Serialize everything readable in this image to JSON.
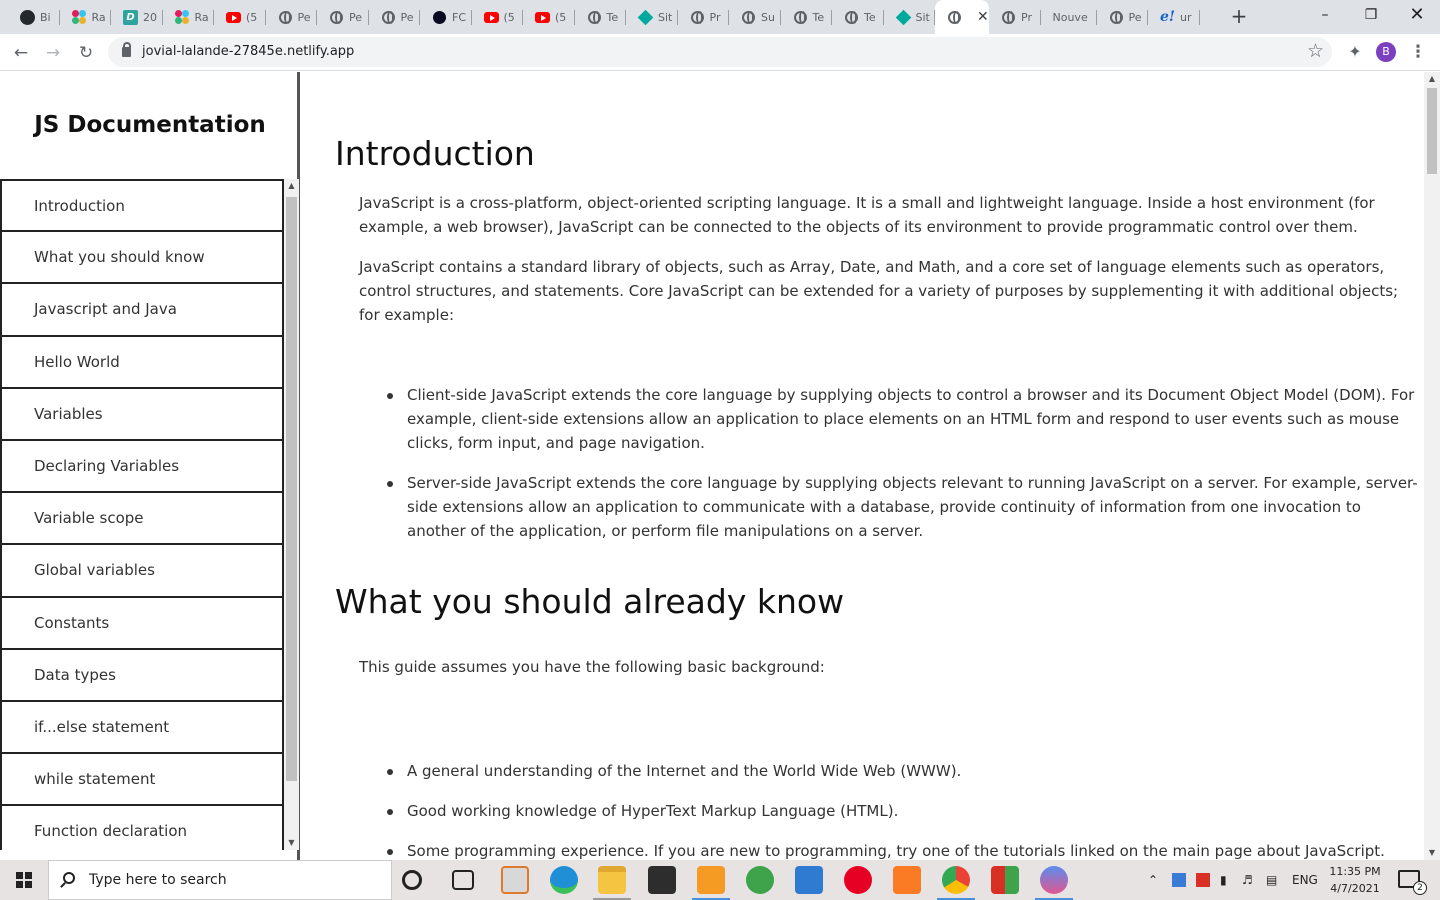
{
  "browser": {
    "tabs": [
      {
        "label": "Bi",
        "favicon": "github-icon"
      },
      {
        "label": "Ra",
        "favicon": "slack-icon"
      },
      {
        "label": "20",
        "favicon": "d-icon"
      },
      {
        "label": "Ra",
        "favicon": "slack-icon"
      },
      {
        "label": "(5",
        "favicon": "youtube-icon"
      },
      {
        "label": "Pe",
        "favicon": "globe-icon"
      },
      {
        "label": "Pe",
        "favicon": "globe-icon"
      },
      {
        "label": "Pe",
        "favicon": "globe-icon"
      },
      {
        "label": "FC",
        "favicon": "freecodecamp-icon"
      },
      {
        "label": "(5",
        "favicon": "youtube-icon"
      },
      {
        "label": "(5",
        "favicon": "youtube-icon"
      },
      {
        "label": "Te",
        "favicon": "globe-icon"
      },
      {
        "label": "Sit",
        "favicon": "diamond-icon"
      },
      {
        "label": "Pr",
        "favicon": "globe-icon"
      },
      {
        "label": "Su",
        "favicon": "globe-icon"
      },
      {
        "label": "Te",
        "favicon": "globe-icon"
      },
      {
        "label": "Te",
        "favicon": "globe-icon"
      },
      {
        "label": "Sit",
        "favicon": "diamond-icon"
      },
      {
        "label": "",
        "favicon": "globe-icon",
        "active": true
      },
      {
        "label": "Pr",
        "favicon": "globe-icon"
      },
      {
        "label": "Nouve",
        "favicon": ""
      },
      {
        "label": "Pe",
        "favicon": "globe-icon"
      },
      {
        "label": "ur",
        "favicon": "e-icon"
      }
    ],
    "url": "jovial-lalande-27845e.netlify.app",
    "profile_initial": "B"
  },
  "page": {
    "nav_title": "JS Documentation",
    "nav_items": [
      "Introduction",
      "What you should know",
      "Javascript and Java",
      "Hello World",
      "Variables",
      "Declaring Variables",
      "Variable scope",
      "Global variables",
      "Constants",
      "Data types",
      "if...else statement",
      "while statement",
      "Function declaration"
    ],
    "sections": [
      {
        "title": "Introduction",
        "paragraphs": [
          "JavaScript is a cross-platform, object-oriented scripting language. It is a small and lightweight language. Inside a host environment (for example, a web browser), JavaScript can be connected to the objects of its environment to provide programmatic control over them.",
          "JavaScript contains a standard library of objects, such as Array, Date, and Math, and a core set of language elements such as operators, control structures, and statements. Core JavaScript can be extended for a variety of purposes by supplementing it with additional objects; for example:"
        ],
        "list": [
          "Client-side JavaScript extends the core language by supplying objects to control a browser and its Document Object Model (DOM). For example, client-side extensions allow an application to place elements on an HTML form and respond to user events such as mouse clicks, form input, and page navigation.",
          "Server-side JavaScript extends the core language by supplying objects relevant to running JavaScript on a server. For example, server-side extensions allow an application to communicate with a database, provide continuity of information from one invocation to another of the application, or perform file manipulations on a server."
        ]
      },
      {
        "title": "What you should already know",
        "paragraphs": [
          "This guide assumes you have the following basic background:"
        ],
        "list": [
          "A general understanding of the Internet and the World Wide Web (WWW).",
          "Good working knowledge of HyperText Markup Language (HTML).",
          "Some programming experience. If you are new to programming, try one of the tutorials linked on the main page about JavaScript."
        ]
      }
    ]
  },
  "taskbar": {
    "search_placeholder": "Type here to search",
    "language": "ENG",
    "time": "11:35 PM",
    "date": "4/7/2021",
    "notification_count": "2",
    "accent_color": "#4a8fd8"
  }
}
